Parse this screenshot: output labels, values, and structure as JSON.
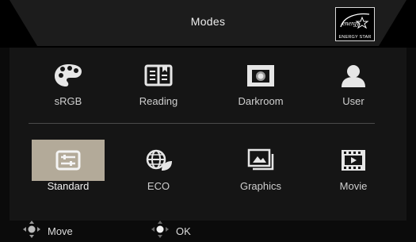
{
  "header": {
    "title": "Modes",
    "logo_text": "ENERGY STAR"
  },
  "modes": [
    {
      "label": "sRGB",
      "icon": "palette-icon"
    },
    {
      "label": "Reading",
      "icon": "book-icon"
    },
    {
      "label": "Darkroom",
      "icon": "darkroom-icon"
    },
    {
      "label": "User",
      "icon": "user-icon"
    },
    {
      "label": "Standard",
      "icon": "sliders-icon",
      "selected": true
    },
    {
      "label": "ECO",
      "icon": "eco-globe-icon"
    },
    {
      "label": "Graphics",
      "icon": "graphics-icon"
    },
    {
      "label": "Movie",
      "icon": "film-icon"
    }
  ],
  "footer": {
    "move_label": "Move",
    "ok_label": "OK"
  },
  "colors": {
    "selected_bg": "#b3aa99",
    "icon": "#e6e6e6"
  }
}
